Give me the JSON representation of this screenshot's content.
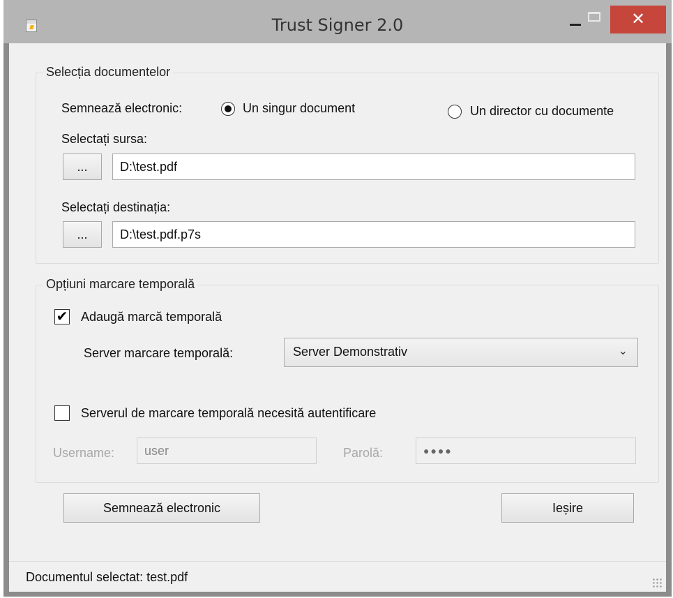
{
  "window": {
    "title": "Trust Signer 2.0",
    "close_glyph": "✕"
  },
  "documents_group": {
    "title": "Selecția documentelor",
    "sign_label": "Semnează electronic:",
    "radio_single": "Un singur document",
    "radio_single_checked": true,
    "radio_directory": "Un director cu documente",
    "radio_directory_checked": false,
    "source_label": "Selectați sursa:",
    "source_browse": "...",
    "source_value": "D:\\test.pdf",
    "dest_label": "Selectați destinația:",
    "dest_browse": "...",
    "dest_value": "D:\\test.pdf.p7s"
  },
  "timestamp_group": {
    "title": "Opțiuni marcare temporală",
    "add_timestamp_label": "Adaugă marcă temporală",
    "add_timestamp_checked": true,
    "check_glyph": "✔",
    "server_label": "Server marcare temporală:",
    "server_value": "Server Demonstrativ",
    "auth_label": "Serverul de marcare temporală necesită autentificare",
    "auth_checked": false,
    "username_label": "Username:",
    "username_value": "user",
    "password_label": "Parolă:",
    "password_value": "●●●●"
  },
  "actions": {
    "sign_button": "Semnează electronic",
    "exit_button": "Ieșire"
  },
  "statusbar": {
    "text": "Documentul selectat: test.pdf"
  },
  "colors": {
    "close_button": "#c7463c",
    "titlebar": "#b5b5b5",
    "client_bg": "#f0f0f0"
  }
}
